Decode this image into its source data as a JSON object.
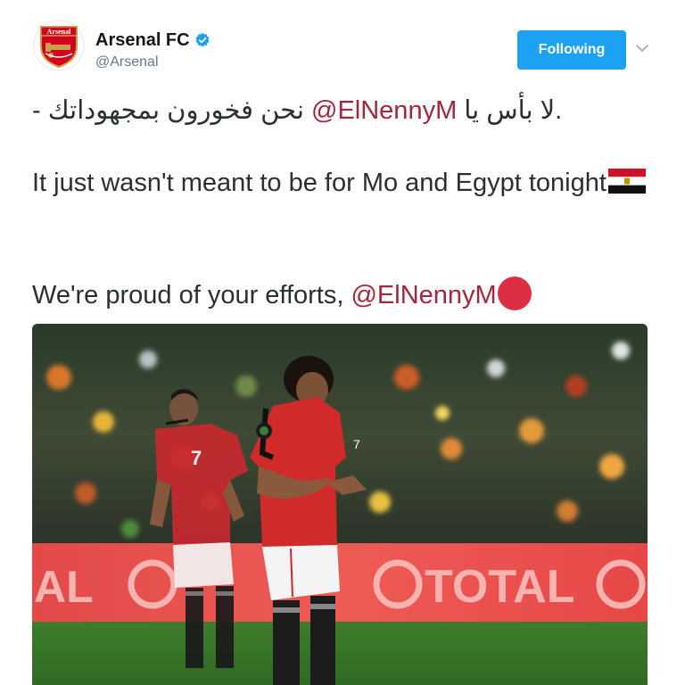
{
  "tweet": {
    "author": {
      "display_name": "Arsenal FC",
      "handle": "@Arsenal",
      "avatar_icon": "arsenal-crest-icon",
      "verified": true,
      "avatar_text": "Arsenal"
    },
    "follow_button_label": "Following",
    "line1": {
      "arabic_after": "نحن فخورون بمجهوداتك -",
      "mention": "@ElNennyM",
      "arabic_before": ".لا بأس يا"
    },
    "line2": {
      "text": "It just wasn't meant to be for Mo and Egypt tonight",
      "emoji": "egypt-flag-icon"
    },
    "line3": {
      "text": "We're proud of your efforts, ",
      "mention": "@ElNennyM",
      "emoji": "red-circle-icon"
    },
    "media": {
      "banner_text": "TOTAL",
      "banner_left_text": "AL",
      "player_front_number": "7",
      "player_back_number": "7"
    }
  },
  "colors": {
    "accent": "#1da1f2",
    "mention": "#a0283a",
    "text": "#292f33",
    "secondary": "#657786"
  }
}
